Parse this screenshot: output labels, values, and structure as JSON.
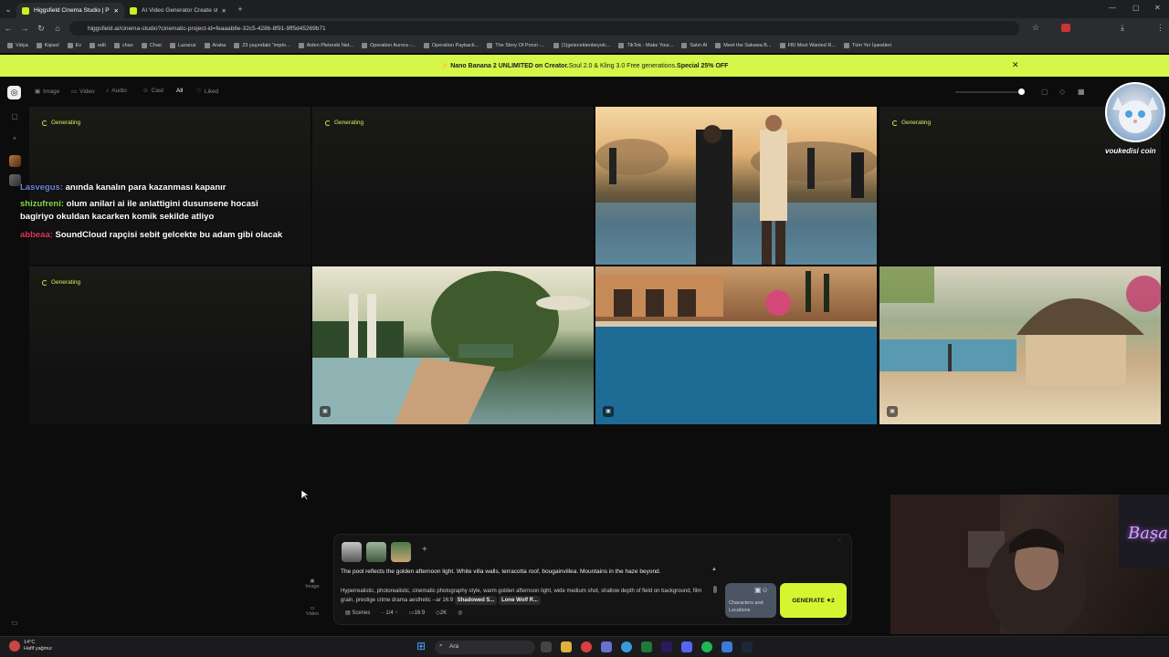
{
  "browser": {
    "tabs": [
      {
        "title": "Higgsfield Cinema Studio | Proj",
        "active": true
      },
      {
        "title": "AI Video Generator Create stu",
        "active": false
      }
    ],
    "url": "higgsfield.ai/cinema-studio?cinematic-project-id=feaaab8e-32c5-428b-8f91-9ff5d45269b71",
    "bookmarks": [
      "Vidya",
      "Kişisel",
      "Ev",
      "edit",
      "chan",
      "Chao",
      "Lazarus",
      "Araba",
      "23 yaşındaki \"impto...",
      "Aiden Pleterski Net...",
      "Operation Aurora -...",
      "Operation Payback...",
      "The Story Of Ponzi -...",
      "(1)gelecektenbeyolc...",
      "TikTok - Make Your...",
      "Satın Al",
      "Meet the Sakawa B...",
      "FBI Most Wanted R...",
      "Tüm Yer İşaretleri"
    ]
  },
  "banner": {
    "bold1": "Nano Banana 2 UNLIMITED on Creator.",
    "text": " Soul 2.0 & Kling 3.0 Free generations. ",
    "bold2": "Special 25% OFF"
  },
  "app": {
    "filters": [
      "Image",
      "Video",
      "Audio",
      "Cast",
      "All",
      "Liked"
    ],
    "active_filter": "All"
  },
  "grid": {
    "generating_label": "Generating",
    "cells": [
      {
        "state": "generating"
      },
      {
        "state": "generating"
      },
      {
        "state": "image",
        "scene": "handshake"
      },
      {
        "state": "generating"
      },
      {
        "state": "generating"
      },
      {
        "state": "image",
        "scene": "garden-pool"
      },
      {
        "state": "image",
        "scene": "villa-pool"
      },
      {
        "state": "image",
        "scene": "thatched-bar"
      }
    ]
  },
  "chat": [
    {
      "user": "Lasvegus:",
      "msg": " anında kanalın para kazanması kapanır"
    },
    {
      "user": "shizufreni:",
      "msg": " olum anilari ai ile anlattigini dusunsene hocasi bagiriyo okuldan kacarken komik sekilde atliyo"
    },
    {
      "user": "abbeaa:",
      "msg": " SoundCloud rapçisi sebit gelcekte bu adam gibi olacak"
    }
  ],
  "prompt": {
    "line1": "The pool reflects the golden afternoon light. White villa walls, terracotta roof, bougainvillea. Mountains in the haze beyond.",
    "line2": "Hyperrealistic, photorealistic, cinematic photography style, warm golden afternoon light, wide medium shot, shallow depth of field on background, film grain, prestige crime drama aesthetic --ar 16:9",
    "chip1": "Shadowed S...",
    "chip2": "Lone Wolf R...",
    "scenes": "Scenes",
    "count": "1/4",
    "ratio": "16:9",
    "res": "2K",
    "characters_btn": "Characters and Locations",
    "generate_btn": "GENERATE",
    "generate_cost": "2",
    "side_image": "Image",
    "side_video": "Video"
  },
  "overlay": {
    "avatar_label": "voukedisi coin",
    "neon_text": "Başa"
  },
  "taskbar": {
    "temp": "14°C",
    "weather": "Hafif yağmur",
    "search": "Ara"
  }
}
